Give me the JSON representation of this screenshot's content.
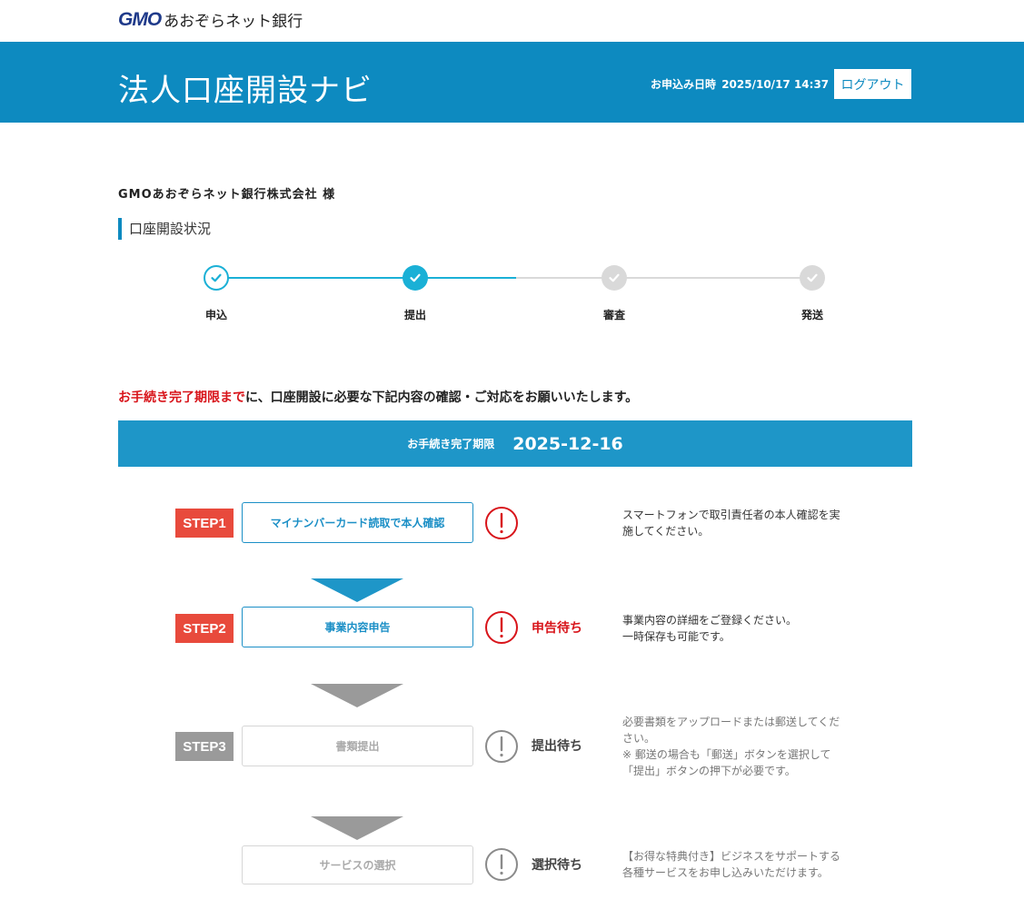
{
  "brand": {
    "logo_mark": "GMO",
    "logo_text": "あおぞらネット銀行"
  },
  "header": {
    "title": "法人口座開設ナビ",
    "apply_label": "お申込み日時",
    "apply_datetime": "2025/10/17 14:37",
    "logout_label": "ログアウト"
  },
  "company_name": "GMOあおぞらネット銀行株式会社 様",
  "section_title": "口座開設状況",
  "progress": {
    "steps": [
      {
        "label": "申込",
        "state": "done"
      },
      {
        "label": "提出",
        "state": "current"
      },
      {
        "label": "審査",
        "state": "pending"
      },
      {
        "label": "発送",
        "state": "pending"
      }
    ]
  },
  "notice": {
    "highlight": "お手続き完了期限まで",
    "rest": "に、口座開設に必要な下記内容の確認・ご対応をお願いいたします。"
  },
  "deadline": {
    "label": "お手続き完了期限",
    "value": "2025-12-16"
  },
  "steps": [
    {
      "badge": "STEP1",
      "button": "マイナンバーカード読取で本人確認",
      "status": "",
      "desc": [
        "スマートフォンで取引責任者の本人確認を実",
        "施してください。"
      ],
      "state": "active"
    },
    {
      "badge": "STEP2",
      "button": "事業内容申告",
      "status": "申告待ち",
      "desc": [
        "事業内容の詳細をご登録ください。",
        "一時保存も可能です。"
      ],
      "state": "active"
    },
    {
      "badge": "STEP3",
      "button": "書類提出",
      "status": "提出待ち",
      "desc": [
        "必要書類をアップロードまたは郵送してくだ",
        "さい。",
        "※ 郵送の場合も「郵送」ボタンを選択して",
        "「提出」ボタンの押下が必要です。"
      ],
      "state": "disabled"
    },
    {
      "badge": "",
      "button": "サービスの選択",
      "status": "選択待ち",
      "desc": [
        "【お得な特典付き】ビジネスをサポートする",
        "各種サービスをお申し込みいただけます。"
      ],
      "state": "disabled"
    }
  ],
  "colors": {
    "header_blue": "#0d8ac0",
    "deadline_blue": "#1e96c8",
    "progress_teal": "#1ab0d6",
    "step_red": "#e84a3c",
    "alert_red": "#d8141a",
    "disabled_gray": "#9a9a9a"
  }
}
